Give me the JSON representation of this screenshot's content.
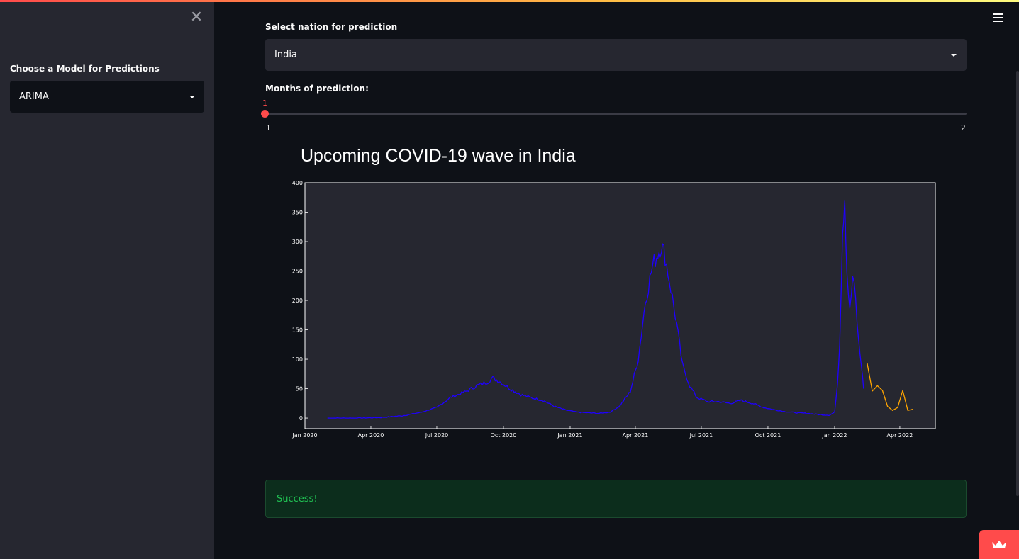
{
  "sidebar": {
    "model_label": "Choose a Model for Predictions",
    "model_value": "ARIMA"
  },
  "main": {
    "nation_label": "Select nation for prediction",
    "nation_value": "India",
    "months_label": "Months of prediction:",
    "slider": {
      "value": "1",
      "min": "1",
      "max": "2",
      "fraction": 0
    },
    "success_text": "Success!"
  },
  "colors": {
    "accent": "#ff4b4b",
    "actual_series": "#1f00ff",
    "forecast_series": "#ffa500",
    "success_text": "#21c354"
  },
  "chart_data": {
    "type": "line",
    "title": "Upcoming COVID-19 wave in India",
    "xlabel": "",
    "ylabel": "",
    "ylim": [
      -18,
      400
    ],
    "yticks": [
      0,
      50,
      100,
      150,
      200,
      250,
      300,
      350,
      400
    ],
    "xlim": [
      "2020-01-01",
      "2022-05-20"
    ],
    "xticks": [
      {
        "date": "2020-01-01",
        "label": "Jan 2020"
      },
      {
        "date": "2020-04-01",
        "label": "Apr 2020"
      },
      {
        "date": "2020-07-01",
        "label": "Jul 2020"
      },
      {
        "date": "2020-10-01",
        "label": "Oct 2020"
      },
      {
        "date": "2021-01-01",
        "label": "Jan 2021"
      },
      {
        "date": "2021-04-01",
        "label": "Apr 2021"
      },
      {
        "date": "2021-07-01",
        "label": "Jul 2021"
      },
      {
        "date": "2021-10-01",
        "label": "Oct 2021"
      },
      {
        "date": "2022-01-01",
        "label": "Jan 2022"
      },
      {
        "date": "2022-04-01",
        "label": "Apr 2022"
      }
    ],
    "grid": false,
    "series": [
      {
        "style": "actual",
        "points": [
          [
            "2020-02-01",
            0
          ],
          [
            "2020-03-15",
            0
          ],
          [
            "2020-04-15",
            1
          ],
          [
            "2020-05-15",
            4
          ],
          [
            "2020-06-10",
            10
          ],
          [
            "2020-07-01",
            18
          ],
          [
            "2020-07-20",
            35
          ],
          [
            "2020-08-10",
            45
          ],
          [
            "2020-08-25",
            55
          ],
          [
            "2020-09-10",
            62
          ],
          [
            "2020-09-16",
            68
          ],
          [
            "2020-09-25",
            63
          ],
          [
            "2020-10-10",
            50
          ],
          [
            "2020-10-25",
            40
          ],
          [
            "2020-11-10",
            34
          ],
          [
            "2020-11-25",
            30
          ],
          [
            "2020-12-10",
            20
          ],
          [
            "2020-12-25",
            14
          ],
          [
            "2021-01-10",
            10
          ],
          [
            "2021-01-25",
            9
          ],
          [
            "2021-02-10",
            8
          ],
          [
            "2021-02-25",
            10
          ],
          [
            "2021-03-10",
            20
          ],
          [
            "2021-03-25",
            45
          ],
          [
            "2021-04-05",
            100
          ],
          [
            "2021-04-15",
            200
          ],
          [
            "2021-04-25",
            260
          ],
          [
            "2021-05-02",
            280
          ],
          [
            "2021-05-07",
            295
          ],
          [
            "2021-05-12",
            275
          ],
          [
            "2021-05-20",
            220
          ],
          [
            "2021-05-28",
            160
          ],
          [
            "2021-06-05",
            90
          ],
          [
            "2021-06-15",
            55
          ],
          [
            "2021-06-25",
            35
          ],
          [
            "2021-07-10",
            28
          ],
          [
            "2021-07-25",
            28
          ],
          [
            "2021-08-10",
            25
          ],
          [
            "2021-08-25",
            30
          ],
          [
            "2021-09-10",
            25
          ],
          [
            "2021-09-25",
            18
          ],
          [
            "2021-10-10",
            14
          ],
          [
            "2021-10-25",
            11
          ],
          [
            "2021-11-10",
            9
          ],
          [
            "2021-11-25",
            8
          ],
          [
            "2021-12-10",
            6
          ],
          [
            "2021-12-25",
            5
          ],
          [
            "2022-01-01",
            10
          ],
          [
            "2022-01-05",
            60
          ],
          [
            "2022-01-08",
            130
          ],
          [
            "2022-01-12",
            320
          ],
          [
            "2022-01-15",
            378
          ],
          [
            "2022-01-18",
            250
          ],
          [
            "2022-01-22",
            180
          ],
          [
            "2022-01-26",
            240
          ],
          [
            "2022-01-30",
            200
          ],
          [
            "2022-02-03",
            130
          ],
          [
            "2022-02-07",
            90
          ],
          [
            "2022-02-10",
            50
          ]
        ]
      },
      {
        "style": "forecast",
        "points": [
          [
            "2022-02-15",
            93
          ],
          [
            "2022-02-22",
            46
          ],
          [
            "2022-03-01",
            55
          ],
          [
            "2022-03-08",
            47
          ],
          [
            "2022-03-15",
            20
          ],
          [
            "2022-03-22",
            13
          ],
          [
            "2022-03-29",
            18
          ],
          [
            "2022-04-05",
            47
          ],
          [
            "2022-04-12",
            13
          ],
          [
            "2022-04-19",
            15
          ]
        ]
      }
    ]
  }
}
